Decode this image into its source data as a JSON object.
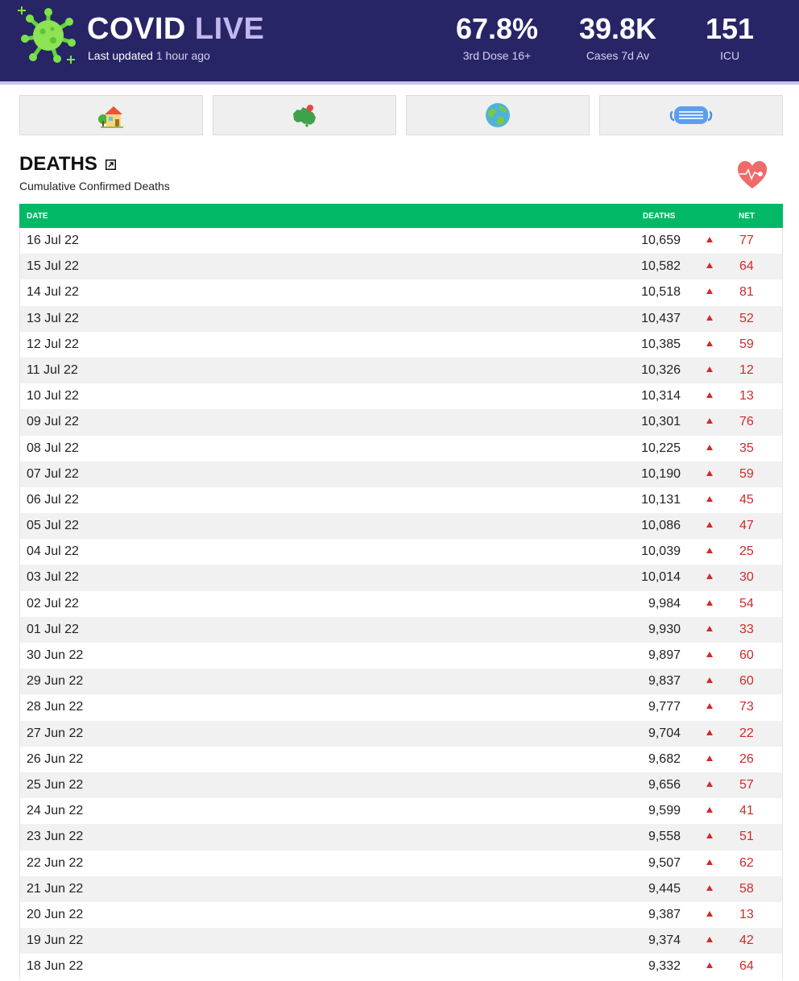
{
  "header": {
    "brand_main": "COVID",
    "brand_accent": "LIVE",
    "updated_label": "Last updated",
    "updated_ago": "1 hour ago",
    "stats": [
      {
        "value": "67.8%",
        "label": "3rd Dose 16+"
      },
      {
        "value": "39.8K",
        "label": "Cases 7d Av"
      },
      {
        "value": "151",
        "label": "ICU"
      }
    ]
  },
  "nav": [
    {
      "icon": "house-icon"
    },
    {
      "icon": "australia-map-icon"
    },
    {
      "icon": "globe-icon"
    },
    {
      "icon": "face-mask-icon"
    }
  ],
  "section": {
    "title": "DEATHS",
    "subtitle": "Cumulative Confirmed Deaths",
    "icon": "heart-pulse-icon"
  },
  "table": {
    "headers": {
      "date": "DATE",
      "deaths": "DEATHS",
      "net": "NET"
    },
    "rows": [
      {
        "date": "16 Jul 22",
        "deaths": "10,659",
        "net": "77"
      },
      {
        "date": "15 Jul 22",
        "deaths": "10,582",
        "net": "64"
      },
      {
        "date": "14 Jul 22",
        "deaths": "10,518",
        "net": "81"
      },
      {
        "date": "13 Jul 22",
        "deaths": "10,437",
        "net": "52"
      },
      {
        "date": "12 Jul 22",
        "deaths": "10,385",
        "net": "59"
      },
      {
        "date": "11 Jul 22",
        "deaths": "10,326",
        "net": "12"
      },
      {
        "date": "10 Jul 22",
        "deaths": "10,314",
        "net": "13"
      },
      {
        "date": "09 Jul 22",
        "deaths": "10,301",
        "net": "76"
      },
      {
        "date": "08 Jul 22",
        "deaths": "10,225",
        "net": "35"
      },
      {
        "date": "07 Jul 22",
        "deaths": "10,190",
        "net": "59"
      },
      {
        "date": "06 Jul 22",
        "deaths": "10,131",
        "net": "45"
      },
      {
        "date": "05 Jul 22",
        "deaths": "10,086",
        "net": "47"
      },
      {
        "date": "04 Jul 22",
        "deaths": "10,039",
        "net": "25"
      },
      {
        "date": "03 Jul 22",
        "deaths": "10,014",
        "net": "30"
      },
      {
        "date": "02 Jul 22",
        "deaths": "9,984",
        "net": "54"
      },
      {
        "date": "01 Jul 22",
        "deaths": "9,930",
        "net": "33"
      },
      {
        "date": "30 Jun 22",
        "deaths": "9,897",
        "net": "60"
      },
      {
        "date": "29 Jun 22",
        "deaths": "9,837",
        "net": "60"
      },
      {
        "date": "28 Jun 22",
        "deaths": "9,777",
        "net": "73"
      },
      {
        "date": "27 Jun 22",
        "deaths": "9,704",
        "net": "22"
      },
      {
        "date": "26 Jun 22",
        "deaths": "9,682",
        "net": "26"
      },
      {
        "date": "25 Jun 22",
        "deaths": "9,656",
        "net": "57"
      },
      {
        "date": "24 Jun 22",
        "deaths": "9,599",
        "net": "41"
      },
      {
        "date": "23 Jun 22",
        "deaths": "9,558",
        "net": "51"
      },
      {
        "date": "22 Jun 22",
        "deaths": "9,507",
        "net": "62"
      },
      {
        "date": "21 Jun 22",
        "deaths": "9,445",
        "net": "58"
      },
      {
        "date": "20 Jun 22",
        "deaths": "9,387",
        "net": "13"
      },
      {
        "date": "19 Jun 22",
        "deaths": "9,374",
        "net": "42"
      },
      {
        "date": "18 Jun 22",
        "deaths": "9,332",
        "net": "64"
      }
    ]
  },
  "colors": {
    "header_bg": "#272566",
    "brand_accent": "#c3b8ee",
    "table_header_bg": "#00b865",
    "increase_red": "#d12a2a"
  }
}
